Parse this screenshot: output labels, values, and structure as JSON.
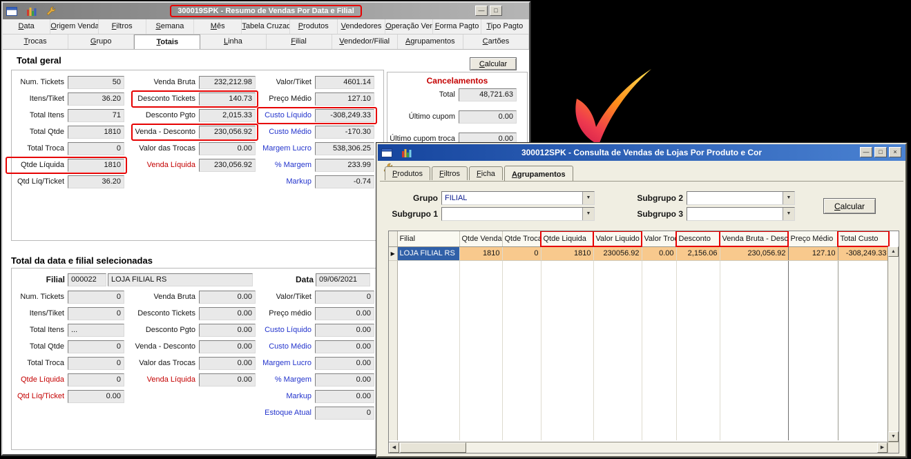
{
  "icons": {
    "minimize": "—",
    "maximize": "□",
    "close": "×",
    "dropdown_arrow": "▼",
    "scroll_up": "▲",
    "scroll_down": "▼",
    "scroll_left": "◀",
    "scroll_right": "▶",
    "row_pointer": "▶"
  },
  "window1": {
    "title": "300019SPK - Resumo de Vendas Por Data e Filial",
    "menu_tabs": [
      "Data",
      "Origem Venda",
      "Filtros",
      "Semana",
      "Mês",
      "Tabela Cruzada",
      "Produtos",
      "Vendedores",
      "Operação Venda",
      "Forma Pagto",
      "Tipo Pagto"
    ],
    "sub_tabs": [
      "Trocas",
      "Grupo",
      "Totais",
      "Linha",
      "Filial",
      "Vendedor/Filial",
      "Agrupamentos",
      "Cartões"
    ],
    "active_sub_tab": "Totais",
    "calcular_label": "Calcular",
    "total_geral": {
      "heading": "Total geral",
      "col1": [
        {
          "label": "Num. Tickets",
          "value": "50"
        },
        {
          "label": "Itens/Tiket",
          "value": "36.20"
        },
        {
          "label": "Total Itens",
          "value": "71"
        },
        {
          "label": "Total Qtde",
          "value": "1810"
        },
        {
          "label": "Total Troca",
          "value": "0"
        },
        {
          "label": "Qtde Líquida",
          "value": "1810"
        },
        {
          "label": "Qtd Líq/Ticket",
          "value": "36.20"
        }
      ],
      "col2": [
        {
          "label": "Venda Bruta",
          "value": "232,212.98"
        },
        {
          "label": "Desconto Tickets",
          "value": "140.73"
        },
        {
          "label": "Desconto Pgto",
          "value": "2,015.33"
        },
        {
          "label": "Venda - Desconto",
          "value": "230,056.92"
        },
        {
          "label": "Valor das Trocas",
          "value": "0.00"
        },
        {
          "label": "Venda Líquida",
          "value": "230,056.92"
        }
      ],
      "col3": [
        {
          "label": "Valor/Tiket",
          "value": "4601.14"
        },
        {
          "label": "Preço Médio",
          "value": "127.10"
        },
        {
          "label": "Custo Líquido",
          "value": "-308,249.33"
        },
        {
          "label": "Custo Médio",
          "value": "-170.30"
        },
        {
          "label": "Margem Lucro",
          "value": "538,306.25"
        },
        {
          "label": "% Margem",
          "value": "233.99"
        },
        {
          "label": "Markup",
          "value": "-0.74"
        }
      ],
      "cancelamentos": {
        "heading": "Cancelamentos",
        "fields": [
          {
            "label": "Total",
            "value": "48,721.63"
          },
          {
            "label": "Último cupom",
            "value": "0.00"
          },
          {
            "label": "Último cupom troca",
            "value": "0.00"
          }
        ]
      }
    },
    "total_data_filial": {
      "heading": "Total da data e filial selecionadas",
      "filial_label": "Filial",
      "filial_code": "000022",
      "filial_name": "LOJA FILIAL RS",
      "data_label": "Data",
      "data_value": "09/06/2021",
      "col1": [
        {
          "label": "Num. Tickets",
          "value": "0"
        },
        {
          "label": "Itens/Tiket",
          "value": "0"
        },
        {
          "label": "Total Itens",
          "value": "..."
        },
        {
          "label": "Total Qtde",
          "value": "0"
        },
        {
          "label": "Total Troca",
          "value": "0"
        },
        {
          "label": "Qtde Líquida",
          "value": "0"
        },
        {
          "label": "Qtd Líq/Ticket",
          "value": "0.00"
        }
      ],
      "col2": [
        {
          "label": "Venda Bruta",
          "value": "0.00"
        },
        {
          "label": "Desconto Tickets",
          "value": "0.00"
        },
        {
          "label": "Desconto Pgto",
          "value": "0.00"
        },
        {
          "label": "Venda - Desconto",
          "value": "0.00"
        },
        {
          "label": "Valor das Trocas",
          "value": "0.00"
        },
        {
          "label": "Venda Líquida",
          "value": "0.00"
        }
      ],
      "col3": [
        {
          "label": "Valor/Tiket",
          "value": "0"
        },
        {
          "label": "Preço médio",
          "value": "0.00"
        },
        {
          "label": "Custo Líquido",
          "value": "0.00"
        },
        {
          "label": "Custo Médio",
          "value": "0.00"
        },
        {
          "label": "Margem Lucro",
          "value": "0.00"
        },
        {
          "label": "% Margem",
          "value": "0.00"
        },
        {
          "label": "Markup",
          "value": "0.00"
        },
        {
          "label": "Estoque Atual",
          "value": "0"
        }
      ]
    }
  },
  "window2": {
    "title": "300012SPK - Consulta de Vendas de Lojas Por Produto e Cor",
    "tabs": [
      "Produtos",
      "Filtros",
      "Ficha",
      "Agrupamentos"
    ],
    "active_tab": "Agrupamentos",
    "filters": {
      "grupo_label": "Grupo",
      "grupo_value": "FILIAL",
      "subgrupo1_label": "Subgrupo 1",
      "subgrupo1_value": "",
      "subgrupo2_label": "Subgrupo 2",
      "subgrupo2_value": "",
      "subgrupo3_label": "Subgrupo 3",
      "subgrupo3_value": "",
      "calcular_label": "Calcular"
    },
    "grid": {
      "columns": [
        "Filial",
        "Qtde Venda",
        "Qtde Troca",
        "Qtde Liquida",
        "Valor Liquido",
        "Valor Troca",
        "Desconto",
        "Venda Bruta - Desc.",
        "Preço Médio",
        "Total Custo"
      ],
      "row": [
        "LOJA FILIAL RS",
        "1810",
        "0",
        "1810",
        "230056.92",
        "0.00",
        "2,156.06",
        "230,056.92",
        "127.10",
        "-308,249.33"
      ]
    }
  }
}
